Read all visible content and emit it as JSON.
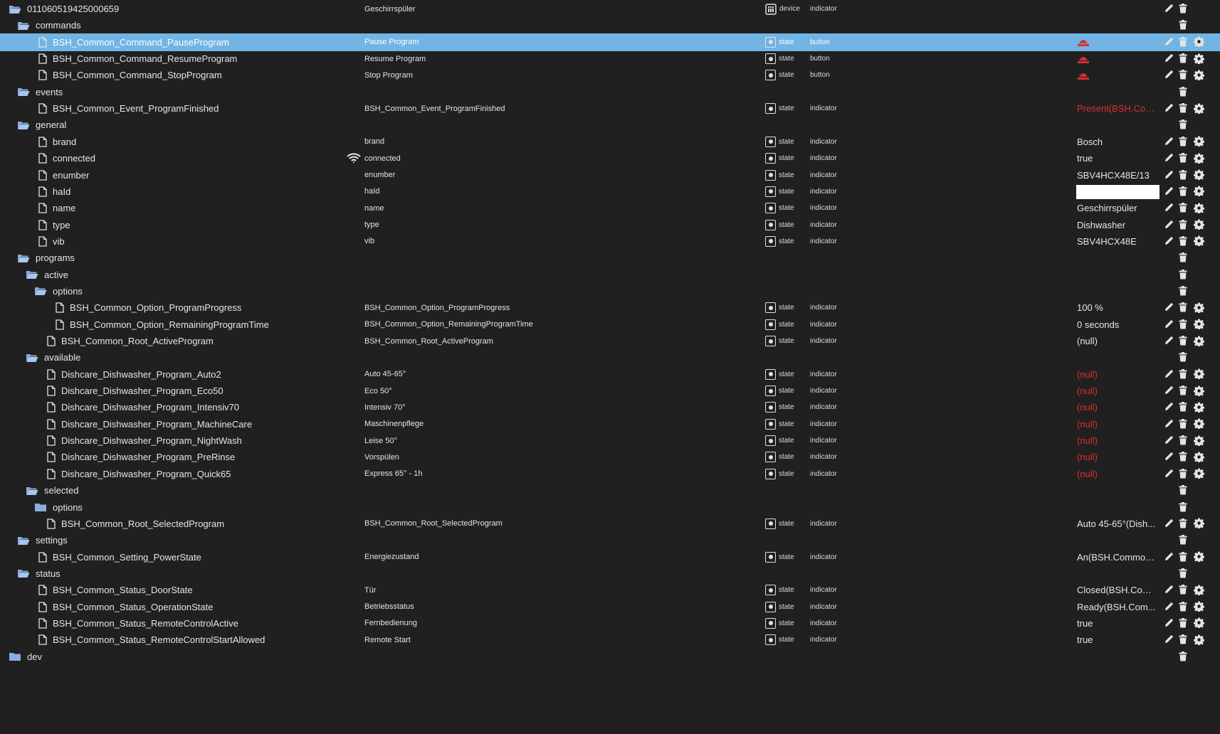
{
  "rows": [
    {
      "id": "011060519425000659",
      "kind": "folder",
      "indent": 0,
      "name": "Geschirrspüler",
      "type": "device",
      "role": "indicator",
      "value": "",
      "actions": "pen-trash"
    },
    {
      "id": "commands",
      "kind": "folder",
      "indent": 1,
      "name": "",
      "type": "",
      "role": "",
      "value": "",
      "actions": "trash"
    },
    {
      "id": "BSH_Common_Command_PauseProgram",
      "kind": "file",
      "indent": 2,
      "name": "Pause Program",
      "type": "state",
      "role": "button",
      "value": "",
      "button": true,
      "selected": true,
      "actions": "all"
    },
    {
      "id": "BSH_Common_Command_ResumeProgram",
      "kind": "file",
      "indent": 2,
      "name": "Resume Program",
      "type": "state",
      "role": "button",
      "value": "",
      "button": true,
      "actions": "all"
    },
    {
      "id": "BSH_Common_Command_StopProgram",
      "kind": "file",
      "indent": 2,
      "name": "Stop Program",
      "type": "state",
      "role": "button",
      "value": "",
      "button": true,
      "actions": "all"
    },
    {
      "id": "events",
      "kind": "folder",
      "indent": 1,
      "name": "",
      "type": "",
      "role": "",
      "value": "",
      "actions": "trash"
    },
    {
      "id": "BSH_Common_Event_ProgramFinished",
      "kind": "file",
      "indent": 2,
      "name": "BSH_Common_Event_ProgramFinished",
      "type": "state",
      "role": "indicator",
      "value": "Present(BSH.Com...",
      "value_red": true,
      "actions": "all"
    },
    {
      "id": "general",
      "kind": "folder",
      "indent": 1,
      "name": "",
      "type": "",
      "role": "",
      "value": "",
      "actions": "trash"
    },
    {
      "id": "brand",
      "kind": "file",
      "indent": 2,
      "name": "brand",
      "type": "state",
      "role": "indicator",
      "value": "Bosch",
      "actions": "all"
    },
    {
      "id": "connected",
      "kind": "file",
      "indent": 2,
      "name": "connected",
      "type": "state",
      "role": "indicator",
      "value": "true",
      "wifi": true,
      "actions": "all"
    },
    {
      "id": "enumber",
      "kind": "file",
      "indent": 2,
      "name": "enumber",
      "type": "state",
      "role": "indicator",
      "value": "SBV4HCX48E/13",
      "actions": "all"
    },
    {
      "id": "haId",
      "kind": "file",
      "indent": 2,
      "name": "haId",
      "type": "state",
      "role": "indicator",
      "value": "",
      "input": true,
      "actions": "all"
    },
    {
      "id": "name",
      "kind": "file",
      "indent": 2,
      "name": "name",
      "type": "state",
      "role": "indicator",
      "value": "Geschirrspüler",
      "actions": "all"
    },
    {
      "id": "type",
      "kind": "file",
      "indent": 2,
      "name": "type",
      "type": "state",
      "role": "indicator",
      "value": "Dishwasher",
      "actions": "all"
    },
    {
      "id": "vib",
      "kind": "file",
      "indent": 2,
      "name": "vib",
      "type": "state",
      "role": "indicator",
      "value": "SBV4HCX48E",
      "actions": "all"
    },
    {
      "id": "programs",
      "kind": "folder",
      "indent": 1,
      "name": "",
      "type": "",
      "role": "",
      "value": "",
      "actions": "trash"
    },
    {
      "id": "active",
      "kind": "folder",
      "indent": 2,
      "name": "",
      "type": "",
      "role": "",
      "value": "",
      "actions": "trash"
    },
    {
      "id": "options",
      "kind": "folder",
      "indent": 3,
      "name": "",
      "type": "",
      "role": "",
      "value": "",
      "actions": "trash"
    },
    {
      "id": "BSH_Common_Option_ProgramProgress",
      "kind": "file",
      "indent": 4,
      "name": "BSH_Common_Option_ProgramProgress",
      "type": "state",
      "role": "indicator",
      "value": "100 %",
      "actions": "all"
    },
    {
      "id": "BSH_Common_Option_RemainingProgramTime",
      "kind": "file",
      "indent": 4,
      "name": "BSH_Common_Option_RemainingProgramTime",
      "type": "state",
      "role": "indicator",
      "value": "0 seconds",
      "actions": "all"
    },
    {
      "id": "BSH_Common_Root_ActiveProgram",
      "kind": "file",
      "indent": 3,
      "name": "BSH_Common_Root_ActiveProgram",
      "type": "state",
      "role": "indicator",
      "value": "(null)",
      "actions": "all"
    },
    {
      "id": "available",
      "kind": "folder",
      "indent": 2,
      "name": "",
      "type": "",
      "role": "",
      "value": "",
      "actions": "trash"
    },
    {
      "id": "Dishcare_Dishwasher_Program_Auto2",
      "kind": "file",
      "indent": 3,
      "name": "Auto 45-65°",
      "type": "state",
      "role": "indicator",
      "value": "(null)",
      "value_red": true,
      "actions": "all"
    },
    {
      "id": "Dishcare_Dishwasher_Program_Eco50",
      "kind": "file",
      "indent": 3,
      "name": "Eco 50°",
      "type": "state",
      "role": "indicator",
      "value": "(null)",
      "value_red": true,
      "actions": "all"
    },
    {
      "id": "Dishcare_Dishwasher_Program_Intensiv70",
      "kind": "file",
      "indent": 3,
      "name": "Intensiv 70°",
      "type": "state",
      "role": "indicator",
      "value": "(null)",
      "value_red": true,
      "actions": "all"
    },
    {
      "id": "Dishcare_Dishwasher_Program_MachineCare",
      "kind": "file",
      "indent": 3,
      "name": "Maschinenpflege",
      "type": "state",
      "role": "indicator",
      "value": "(null)",
      "value_red": true,
      "actions": "all"
    },
    {
      "id": "Dishcare_Dishwasher_Program_NightWash",
      "kind": "file",
      "indent": 3,
      "name": "Leise 50°",
      "type": "state",
      "role": "indicator",
      "value": "(null)",
      "value_red": true,
      "actions": "all"
    },
    {
      "id": "Dishcare_Dishwasher_Program_PreRinse",
      "kind": "file",
      "indent": 3,
      "name": "Vorspülen",
      "type": "state",
      "role": "indicator",
      "value": "(null)",
      "value_red": true,
      "actions": "all"
    },
    {
      "id": "Dishcare_Dishwasher_Program_Quick65",
      "kind": "file",
      "indent": 3,
      "name": "Express 65° - 1h",
      "type": "state",
      "role": "indicator",
      "value": "(null)",
      "value_red": true,
      "actions": "all"
    },
    {
      "id": "selected",
      "kind": "folder",
      "indent": 2,
      "name": "",
      "type": "",
      "role": "",
      "value": "",
      "actions": "trash"
    },
    {
      "id": "options",
      "kind": "folder-closed",
      "indent": 3,
      "name": "",
      "type": "",
      "role": "",
      "value": "",
      "actions": "trash"
    },
    {
      "id": "BSH_Common_Root_SelectedProgram",
      "kind": "file",
      "indent": 3,
      "name": "BSH_Common_Root_SelectedProgram",
      "type": "state",
      "role": "indicator",
      "value": "Auto 45-65°(Dish...",
      "actions": "all"
    },
    {
      "id": "settings",
      "kind": "folder",
      "indent": 1,
      "name": "",
      "type": "",
      "role": "",
      "value": "",
      "actions": "trash"
    },
    {
      "id": "BSH_Common_Setting_PowerState",
      "kind": "file",
      "indent": 2,
      "name": "Energiezustand",
      "type": "state",
      "role": "indicator",
      "value": "An(BSH.Common....",
      "actions": "all"
    },
    {
      "id": "status",
      "kind": "folder",
      "indent": 1,
      "name": "",
      "type": "",
      "role": "",
      "value": "",
      "actions": "trash"
    },
    {
      "id": "BSH_Common_Status_DoorState",
      "kind": "file",
      "indent": 2,
      "name": "Tür",
      "type": "state",
      "role": "indicator",
      "value": "Closed(BSH.Com...",
      "actions": "all"
    },
    {
      "id": "BSH_Common_Status_OperationState",
      "kind": "file",
      "indent": 2,
      "name": "Betriebsstatus",
      "type": "state",
      "role": "indicator",
      "value": "Ready(BSH.Com...",
      "actions": "all"
    },
    {
      "id": "BSH_Common_Status_RemoteControlActive",
      "kind": "file",
      "indent": 2,
      "name": "Fernbedienung",
      "type": "state",
      "role": "indicator",
      "value": "true",
      "actions": "all"
    },
    {
      "id": "BSH_Common_Status_RemoteControlStartAllowed",
      "kind": "file",
      "indent": 2,
      "name": "Remote Start",
      "type": "state",
      "role": "indicator",
      "value": "true",
      "actions": "all"
    },
    {
      "id": "dev",
      "kind": "folder-closed",
      "indent": 0,
      "name": "",
      "type": "",
      "role": "",
      "value": "",
      "actions": "trash"
    }
  ],
  "colors": {
    "background": "#202020",
    "selected_row": "#72b4e4",
    "folder_icon": "#88aee0",
    "button_icon": "#d63030",
    "red_value": "#d63030"
  },
  "icons": {
    "folder_open": "folder-open-icon",
    "folder_closed": "folder-icon",
    "file": "file-icon",
    "device": "device-icon",
    "state": "state-icon",
    "wifi": "wifi-icon",
    "button": "button-press-icon",
    "edit": "pencil-icon",
    "delete": "trash-icon",
    "settings": "gear-icon"
  }
}
